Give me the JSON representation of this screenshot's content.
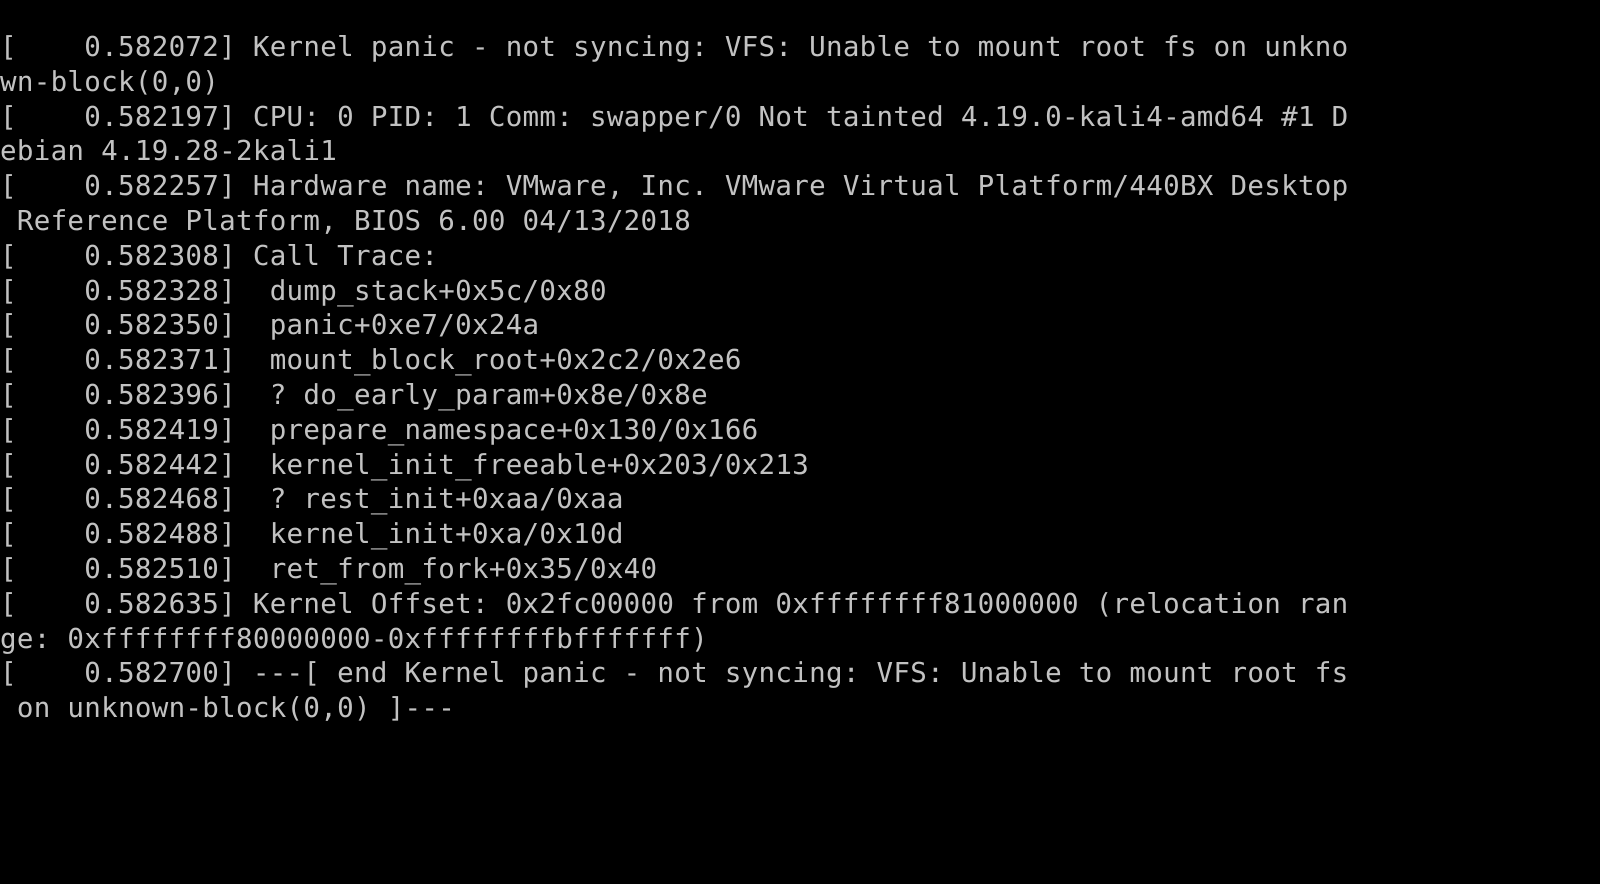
{
  "screen": {
    "type": "linux-kernel-panic-console",
    "background_color": "#000000",
    "text_color": "#c2c2c2",
    "columns": 93,
    "rows": 25
  },
  "console": {
    "lines": [
      "[    0.582072] Kernel panic - not syncing: VFS: Unable to mount root fs on unkno",
      "wn-block(0,0)",
      "[    0.582197] CPU: 0 PID: 1 Comm: swapper/0 Not tainted 4.19.0-kali4-amd64 #1 D",
      "ebian 4.19.28-2kali1",
      "[    0.582257] Hardware name: VMware, Inc. VMware Virtual Platform/440BX Desktop",
      " Reference Platform, BIOS 6.00 04/13/2018",
      "[    0.582308] Call Trace:",
      "[    0.582328]  dump_stack+0x5c/0x80",
      "[    0.582350]  panic+0xe7/0x24a",
      "[    0.582371]  mount_block_root+0x2c2/0x2e6",
      "[    0.582396]  ? do_early_param+0x8e/0x8e",
      "[    0.582419]  prepare_namespace+0x130/0x166",
      "[    0.582442]  kernel_init_freeable+0x203/0x213",
      "[    0.582468]  ? rest_init+0xaa/0xaa",
      "[    0.582488]  kernel_init+0xa/0x10d",
      "[    0.582510]  ret_from_fork+0x35/0x40",
      "[    0.582635] Kernel Offset: 0x2fc00000 from 0xffffffff81000000 (relocation ran",
      "ge: 0xffffffff80000000-0xffffffffbfffffff)",
      "[    0.582700] ---[ end Kernel panic - not syncing: VFS: Unable to mount root fs",
      " on unknown-block(0,0) ]---"
    ],
    "entries": [
      {
        "timestamp": "0.582072",
        "message": "Kernel panic - not syncing: VFS: Unable to mount root fs on unknown-block(0,0)"
      },
      {
        "timestamp": "0.582197",
        "message": "CPU: 0 PID: 1 Comm: swapper/0 Not tainted 4.19.0-kali4-amd64 #1 Debian 4.19.28-2kali1"
      },
      {
        "timestamp": "0.582257",
        "message": "Hardware name: VMware, Inc. VMware Virtual Platform/440BX Desktop Reference Platform, BIOS 6.00 04/13/2018"
      },
      {
        "timestamp": "0.582308",
        "message": "Call Trace:"
      },
      {
        "timestamp": "0.582328",
        "message": " dump_stack+0x5c/0x80"
      },
      {
        "timestamp": "0.582350",
        "message": " panic+0xe7/0x24a"
      },
      {
        "timestamp": "0.582371",
        "message": " mount_block_root+0x2c2/0x2e6"
      },
      {
        "timestamp": "0.582396",
        "message": " ? do_early_param+0x8e/0x8e"
      },
      {
        "timestamp": "0.582419",
        "message": " prepare_namespace+0x130/0x166"
      },
      {
        "timestamp": "0.582442",
        "message": " kernel_init_freeable+0x203/0x213"
      },
      {
        "timestamp": "0.582468",
        "message": " ? rest_init+0xaa/0xaa"
      },
      {
        "timestamp": "0.582488",
        "message": " kernel_init+0xa/0x10d"
      },
      {
        "timestamp": "0.582510",
        "message": " ret_from_fork+0x35/0x40"
      },
      {
        "timestamp": "0.582635",
        "message": "Kernel Offset: 0x2fc00000 from 0xffffffff81000000 (relocation range: 0xffffffff80000000-0xffffffffbfffffff)"
      },
      {
        "timestamp": "0.582700",
        "message": "---[ end Kernel panic - not syncing: VFS: Unable to mount root fs on unknown-block(0,0) ]---"
      }
    ],
    "details": {
      "panic_reason": "VFS: Unable to mount root fs on unknown-block(0,0)",
      "cpu": "0",
      "pid": "1",
      "comm": "swapper/0",
      "taint_state": "Not tainted",
      "kernel_version": "4.19.0-kali4-amd64",
      "build_number": "#1",
      "distro_build": "Debian 4.19.28-2kali1",
      "hardware_vendor": "VMware, Inc.",
      "hardware_name": "VMware Virtual Platform/440BX Desktop Reference Platform",
      "bios_version": "BIOS 6.00",
      "bios_date": "04/13/2018",
      "kernel_offset": "0x2fc00000",
      "kernel_offset_from": "0xffffffff81000000",
      "relocation_range_start": "0xffffffff80000000",
      "relocation_range_end": "0xffffffffbfffffff",
      "call_trace": [
        "dump_stack+0x5c/0x80",
        "panic+0xe7/0x24a",
        "mount_block_root+0x2c2/0x2e6",
        "? do_early_param+0x8e/0x8e",
        "prepare_namespace+0x130/0x166",
        "kernel_init_freeable+0x203/0x213",
        "? rest_init+0xaa/0xaa",
        "kernel_init+0xa/0x10d",
        "ret_from_fork+0x35/0x40"
      ]
    }
  }
}
